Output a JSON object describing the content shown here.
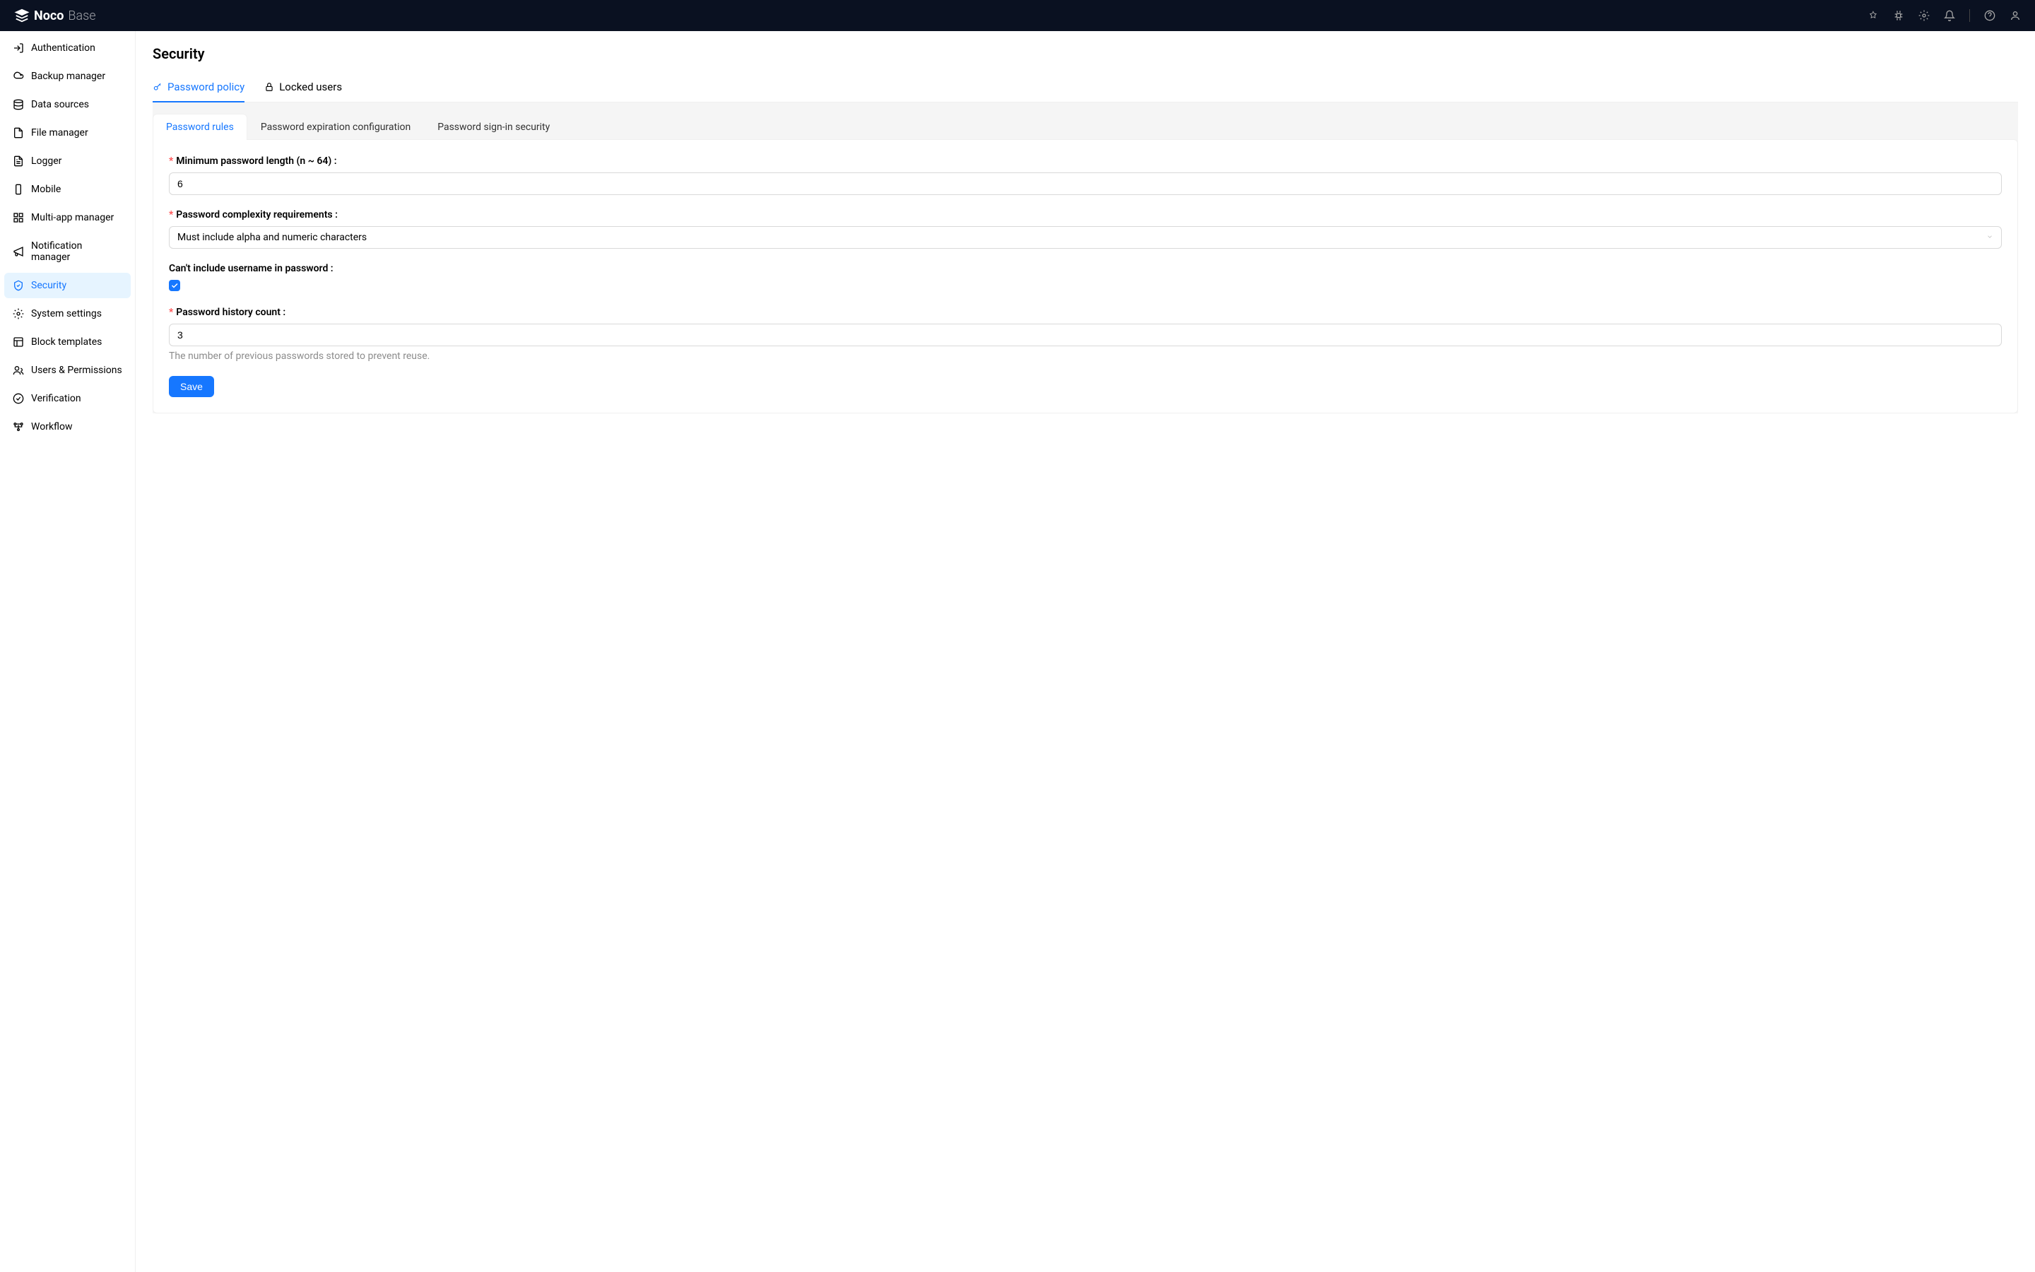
{
  "brand": {
    "name1": "Noco",
    "name2": "Base"
  },
  "sidebar": {
    "items": [
      {
        "label": "Authentication"
      },
      {
        "label": "Backup manager"
      },
      {
        "label": "Data sources"
      },
      {
        "label": "File manager"
      },
      {
        "label": "Logger"
      },
      {
        "label": "Mobile"
      },
      {
        "label": "Multi-app manager"
      },
      {
        "label": "Notification manager"
      },
      {
        "label": "Security"
      },
      {
        "label": "System settings"
      },
      {
        "label": "Block templates"
      },
      {
        "label": "Users & Permissions"
      },
      {
        "label": "Verification"
      },
      {
        "label": "Workflow"
      }
    ]
  },
  "page": {
    "title": "Security"
  },
  "mainTabs": [
    {
      "label": "Password policy"
    },
    {
      "label": "Locked users"
    }
  ],
  "subTabs": [
    {
      "label": "Password rules"
    },
    {
      "label": "Password expiration configuration"
    },
    {
      "label": "Password sign-in security"
    }
  ],
  "form": {
    "minLengthLabel": "Minimum password length (n ~ 64) :",
    "minLengthValue": "6",
    "complexityLabel": "Password complexity requirements :",
    "complexityValue": "Must include alpha and numeric characters",
    "usernameLabel": "Can't include username in password :",
    "usernameChecked": true,
    "historyLabel": "Password history count :",
    "historyValue": "3",
    "historyHelp": "The number of previous passwords stored to prevent reuse.",
    "saveLabel": "Save"
  }
}
